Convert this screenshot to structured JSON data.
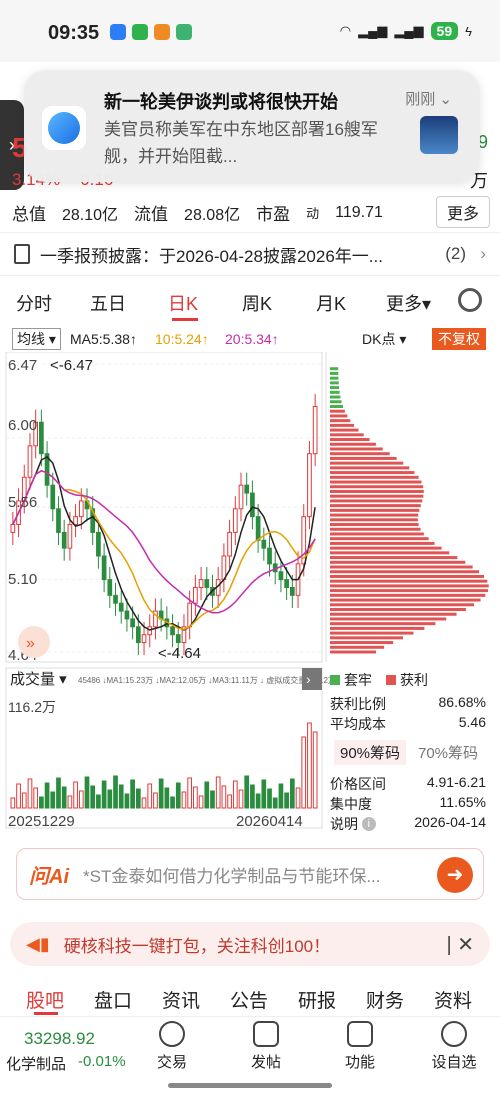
{
  "status": {
    "time": "09:35",
    "battery": "59"
  },
  "notification": {
    "title": "新一轮美伊谈判或将很快开始",
    "time": "刚刚",
    "body": "美官员称美军在中东地区部署16艘军舰，并开始阻截..."
  },
  "quote": {
    "price_partial": "5",
    "change_pct": "3.14%",
    "change_abs": "0.16",
    "right_value": "9",
    "right_unit": "万",
    "total_value_label": "总值",
    "total_value": "28.10亿",
    "float_label": "流值",
    "float_value": "28.08亿",
    "pe_label": "市盈",
    "pe_sup": "动",
    "pe_value": "119.71",
    "more": "更多"
  },
  "announcement": {
    "text": "一季报预披露：于2026-04-28披露2026年一...",
    "count": "(2)"
  },
  "period_tabs": [
    "分时",
    "五日",
    "日K",
    "周K",
    "月K",
    "更多"
  ],
  "active_tab": "日K",
  "ma": {
    "selector": "均线",
    "ma5": "MA5:5.38↑",
    "ma10": "10:5.24↑",
    "ma20": "20:5.34↑",
    "dk": "DK点",
    "fq": "不复权"
  },
  "chart_labels": {
    "high_label": "6.47",
    "high_arrow": "<-6.47",
    "y_600": "6.00",
    "y_556": "5.56",
    "y_510": "5.10",
    "low_label": "4.64",
    "low_arrow": "<-4.64",
    "vol_selector": "成交量",
    "vol_info": "45486 ↓MA1:15.23万 ↓MA2:12.05万 ↓MA3:11.11万 ↓ 虚拟成交量:116.2万",
    "vol_max": "116.2万",
    "date_start": "20251229",
    "date_end": "20260414"
  },
  "chip_panel": {
    "legend_trapped": "套牢",
    "legend_profit": "获利",
    "profit_ratio_label": "获利比例",
    "profit_ratio": "86.68%",
    "avg_cost_label": "平均成本",
    "avg_cost": "5.46",
    "chip90": "90%筹码",
    "chip70": "70%筹码",
    "range_label": "价格区间",
    "range": "4.91-6.21",
    "concentration_label": "集中度",
    "concentration": "11.65%",
    "note_label": "说明",
    "note_date": "2026-04-14"
  },
  "ai": {
    "logo": "问Ai",
    "prompt": "*ST金泰如何借力化学制品与节能环保..."
  },
  "promo": {
    "text": "硬核科技一键打包，关注科创100！"
  },
  "bottom_tabs": [
    "股吧",
    "盘口",
    "资讯",
    "公告",
    "研报",
    "财务",
    "资料"
  ],
  "footer": {
    "index_value": "33298.92",
    "index_name": "化学制品",
    "index_pct": "-0.01%",
    "buttons": [
      "交易",
      "发帖",
      "功能",
      "设自选"
    ]
  },
  "colors": {
    "up": "#e03a3a",
    "down": "#2a8c3e",
    "accent": "#ea5a1f"
  },
  "chart_data": {
    "type": "candlestick",
    "ylim": [
      4.64,
      6.47
    ],
    "y_ticks": [
      "6.47",
      "6.00",
      "5.56",
      "5.10",
      "4.64"
    ],
    "x_range": [
      "20251229",
      "20260414"
    ],
    "high": 6.47,
    "low": 4.64,
    "ma": {
      "MA5": 5.38,
      "MA10": 5.24,
      "MA20": 5.34
    },
    "volume_max": "116.2万",
    "closes": [
      5.45,
      5.6,
      5.75,
      5.95,
      6.1,
      5.9,
      5.7,
      5.55,
      5.4,
      5.3,
      5.45,
      5.5,
      5.6,
      5.55,
      5.4,
      5.25,
      5.1,
      5.0,
      4.95,
      4.9,
      4.85,
      4.8,
      4.7,
      4.75,
      4.8,
      4.9,
      4.85,
      4.8,
      4.75,
      4.7,
      4.8,
      4.95,
      5.05,
      5.1,
      5.05,
      5.0,
      5.1,
      5.25,
      5.4,
      5.55,
      5.7,
      5.65,
      5.5,
      5.35,
      5.3,
      5.2,
      5.15,
      5.1,
      5.05,
      5.0,
      5.2,
      5.5,
      5.9,
      6.2
    ]
  }
}
